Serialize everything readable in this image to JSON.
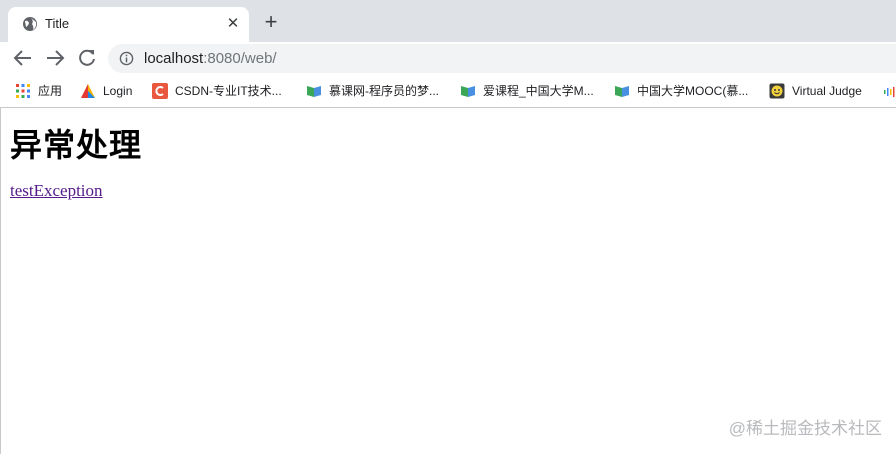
{
  "tab": {
    "title": "Title",
    "close_symbol": "✕",
    "new_tab_symbol": "+"
  },
  "omnibox": {
    "host": "localhost",
    "rest": ":8080/web/"
  },
  "bookmarks": [
    {
      "label": "应用",
      "icon": "apps-grid-icon"
    },
    {
      "label": "Login",
      "icon": "login-favicon"
    },
    {
      "label": "CSDN-专业IT技术...",
      "icon": "csdn-icon"
    },
    {
      "label": "慕课网-程序员的梦...",
      "icon": "imooc-icon"
    },
    {
      "label": "爱课程_中国大学M...",
      "icon": "icourse-icon"
    },
    {
      "label": "中国大学MOOC(慕...",
      "icon": "mooc-icon"
    },
    {
      "label": "Virtual Judge",
      "icon": "vjudge-icon"
    }
  ],
  "page": {
    "heading": "异常处理",
    "link": "testException"
  },
  "watermark": "@稀土掘金技术社区",
  "colors": {
    "tabstrip": "#dee1e6",
    "omnibox": "#f1f3f4",
    "visited_link": "#551a8b",
    "csdn": "#e9573f",
    "book_green": "#3aa757",
    "book_blue": "#4a90e2"
  }
}
